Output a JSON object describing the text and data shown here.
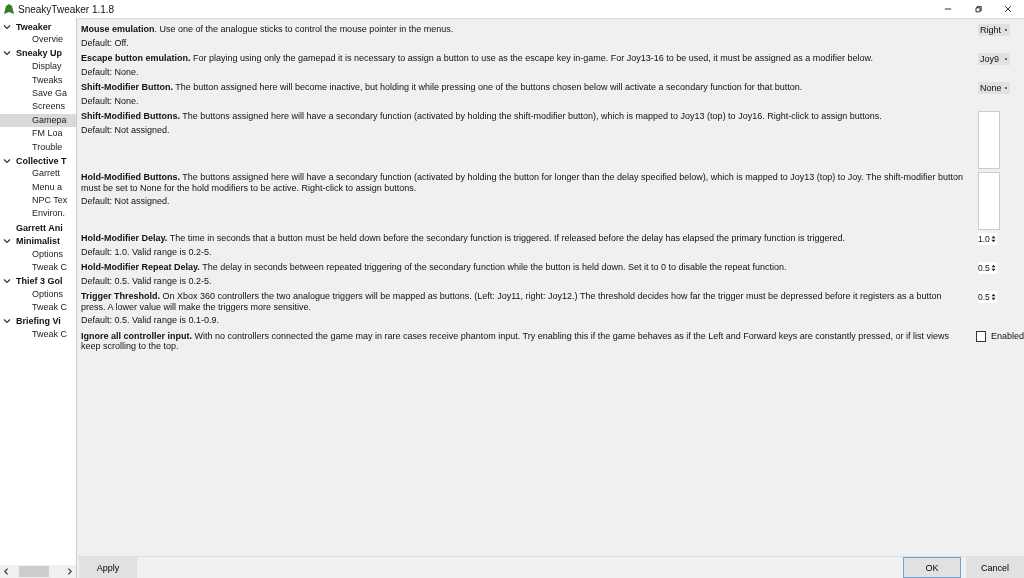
{
  "window": {
    "title": "SneakyTweaker 1.1.8"
  },
  "sidebar": {
    "items": [
      {
        "label": "Tweaker",
        "expanded": true,
        "selected": false,
        "children": [
          {
            "label": "Overvie",
            "selected": false
          }
        ]
      },
      {
        "label": "Sneaky Up",
        "expanded": true,
        "selected": false,
        "children": [
          {
            "label": "Display",
            "selected": false
          },
          {
            "label": "Tweaks",
            "selected": false
          },
          {
            "label": "Save Ga",
            "selected": false
          },
          {
            "label": "Screens",
            "selected": false
          },
          {
            "label": "Gamepa",
            "selected": true
          },
          {
            "label": "FM Loa",
            "selected": false
          },
          {
            "label": "Trouble",
            "selected": false
          }
        ]
      },
      {
        "label": "Collective T",
        "expanded": true,
        "selected": false,
        "children": [
          {
            "label": "Garrett",
            "selected": false
          },
          {
            "label": "Menu a",
            "selected": false
          },
          {
            "label": "NPC Tex",
            "selected": false
          },
          {
            "label": "Environ.",
            "selected": false
          }
        ]
      },
      {
        "label": "Garrett Ani",
        "selected": false
      },
      {
        "label": "Minimalist",
        "expanded": true,
        "selected": false,
        "children": [
          {
            "label": "Options",
            "selected": false
          },
          {
            "label": "Tweak C",
            "selected": false
          }
        ]
      },
      {
        "label": "Thief 3 Gol",
        "expanded": true,
        "selected": false,
        "children": [
          {
            "label": "Options",
            "selected": false
          },
          {
            "label": "Tweak C",
            "selected": false
          }
        ]
      },
      {
        "label": "Briefing Vi",
        "expanded": true,
        "selected": false,
        "children": [
          {
            "label": "Tweak C",
            "selected": false
          }
        ]
      }
    ]
  },
  "settings": [
    {
      "text": "**Mouse emulation**. Use one of the analogue sticks to control the mouse pointer in the menus.",
      "default": "Default: Off.",
      "control": {
        "kind": "dropdown",
        "value": "Right"
      }
    },
    {
      "text": "**Escape button emulation.** For playing using only the gamepad it is necessary to assign a button to use as the escape key in-game. For Joy13-16 to be used, it must be assigned as a modifier below.",
      "default": "Default: None.",
      "control": {
        "kind": "dropdown",
        "value": "Joy9"
      }
    },
    {
      "text": "**Shift-Modifier Button.** The button assigned here will become inactive, but holding it while pressing one of the buttons chosen below will activate a secondary function for that button.",
      "default": "Default: None.",
      "control": {
        "kind": "dropdown",
        "value": "None"
      }
    },
    {
      "text": "**Shift-Modified Buttons.** The buttons assigned here will have a secondary function (activated by holding the shift-modifier button), which is mapped to Joy13 (top) to Joy16. Right-click to assign buttons.",
      "default": "Default: Not assigned.",
      "control": {
        "kind": "list"
      }
    },
    {
      "text": "**Hold-Modified Buttons.** The buttons assigned here will have a secondary function (activated by holding the button for longer than the delay specified below), which is mapped to Joy13 (top) to Joy. The shift-modifier button must be set to None for the hold modifiers to be active. Right-click to assign buttons.",
      "default": "Default: Not assigned.",
      "control": {
        "kind": "list"
      }
    },
    {
      "text": "**Hold-Modifier Delay.** The time in seconds that a button must be held down before the secondary function is triggered. If released before the delay has elapsed the primary function is triggered.",
      "default": "Default: 1.0. Valid range is 0.2-5.",
      "control": {
        "kind": "spin",
        "value": "1.0"
      }
    },
    {
      "text": "**Hold-Modifier Repeat Delay.** The delay in seconds between repeated triggering of the secondary function while the button is held down. Set it to 0 to disable the repeat function.",
      "default": "Default: 0.5. Valid range is 0.2-5.",
      "control": {
        "kind": "spin",
        "value": "0.5"
      }
    },
    {
      "text": "**Trigger Threshold.** On Xbox 360 controllers the two analogue triggers will be mapped as buttons. (Left: Joy11, right: Joy12.) The threshold decides how far the trigger must be depressed before it registers as a button press. A lower value will make the triggers more sensitive.",
      "default": "Default: 0.5. Valid range is 0.1-0.9.",
      "control": {
        "kind": "spin",
        "value": "0.5"
      }
    },
    {
      "text": "**Ignore all controller input.** With no controllers connected the game may in rare cases receive phantom input. Try enabling this if the game behaves as if the Left and Forward keys are constantly pressed, or if list views keep scrolling to the top.",
      "control": {
        "kind": "checkbox",
        "checked": false,
        "label": "Enabled"
      }
    }
  ],
  "buttons": {
    "apply": "Apply",
    "ok": "OK",
    "cancel": "Cancel"
  }
}
